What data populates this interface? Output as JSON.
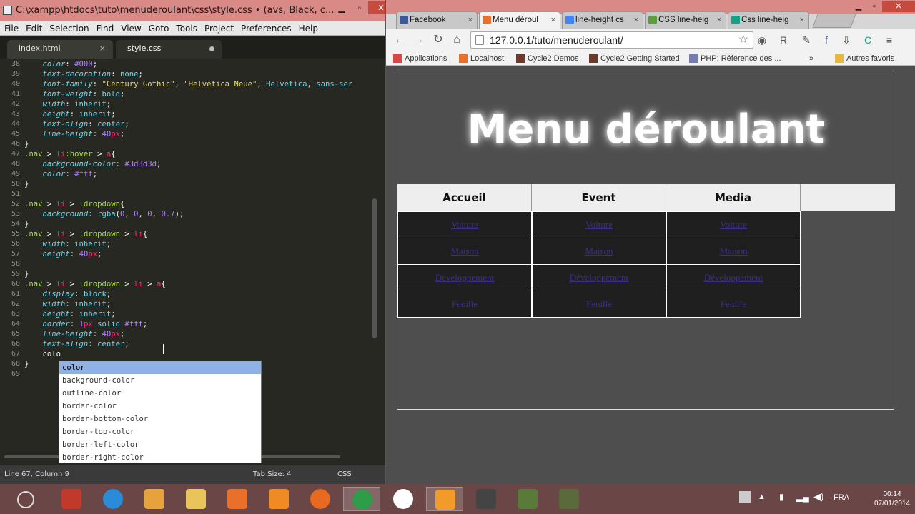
{
  "sublime": {
    "title": "C:\\xampp\\htdocs\\tuto\\menuderoulant\\css\\style.css • (avs, Black, c...",
    "menu": [
      "File",
      "Edit",
      "Selection",
      "Find",
      "View",
      "Goto",
      "Tools",
      "Project",
      "Preferences",
      "Help"
    ],
    "tabs": [
      {
        "label": "index.html",
        "close": "×"
      },
      {
        "label": "style.css"
      }
    ],
    "typed": "colo",
    "autocomplete": [
      "color",
      "background-color",
      "outline-color",
      "border-color",
      "border-bottom-color",
      "border-top-color",
      "border-left-color",
      "border-right-color"
    ],
    "status": {
      "position": "Line 67, Column 9",
      "tab_size": "Tab Size: 4",
      "syntax": "CSS"
    }
  },
  "chrome": {
    "tabs": [
      {
        "label": "Facebook",
        "color": "#3b5998"
      },
      {
        "label": "Menu déroul",
        "color": "#e8702a"
      },
      {
        "label": "line-height cs",
        "color": "#4285f4"
      },
      {
        "label": "CSS line-heig",
        "color": "#5b9e3a"
      },
      {
        "label": "Css line-heig",
        "color": "#16a085"
      }
    ],
    "url": "127.0.0.1/tuto/menuderoulant/",
    "bookmarks": [
      "Applications",
      "Localhost",
      "Cycle2 Demos",
      "Cycle2 Getting Started",
      "PHP: Référence des ...",
      "»",
      "Autres favoris"
    ]
  },
  "page": {
    "title": "Menu déroulant",
    "nav": [
      "Accueil",
      "Event",
      "Media"
    ],
    "dropdown": [
      "Voiture",
      "Maison",
      "Développement",
      "Feuille"
    ]
  },
  "taskbar": {
    "language": "FRA",
    "time": "00:14",
    "date": "07/01/2014"
  }
}
